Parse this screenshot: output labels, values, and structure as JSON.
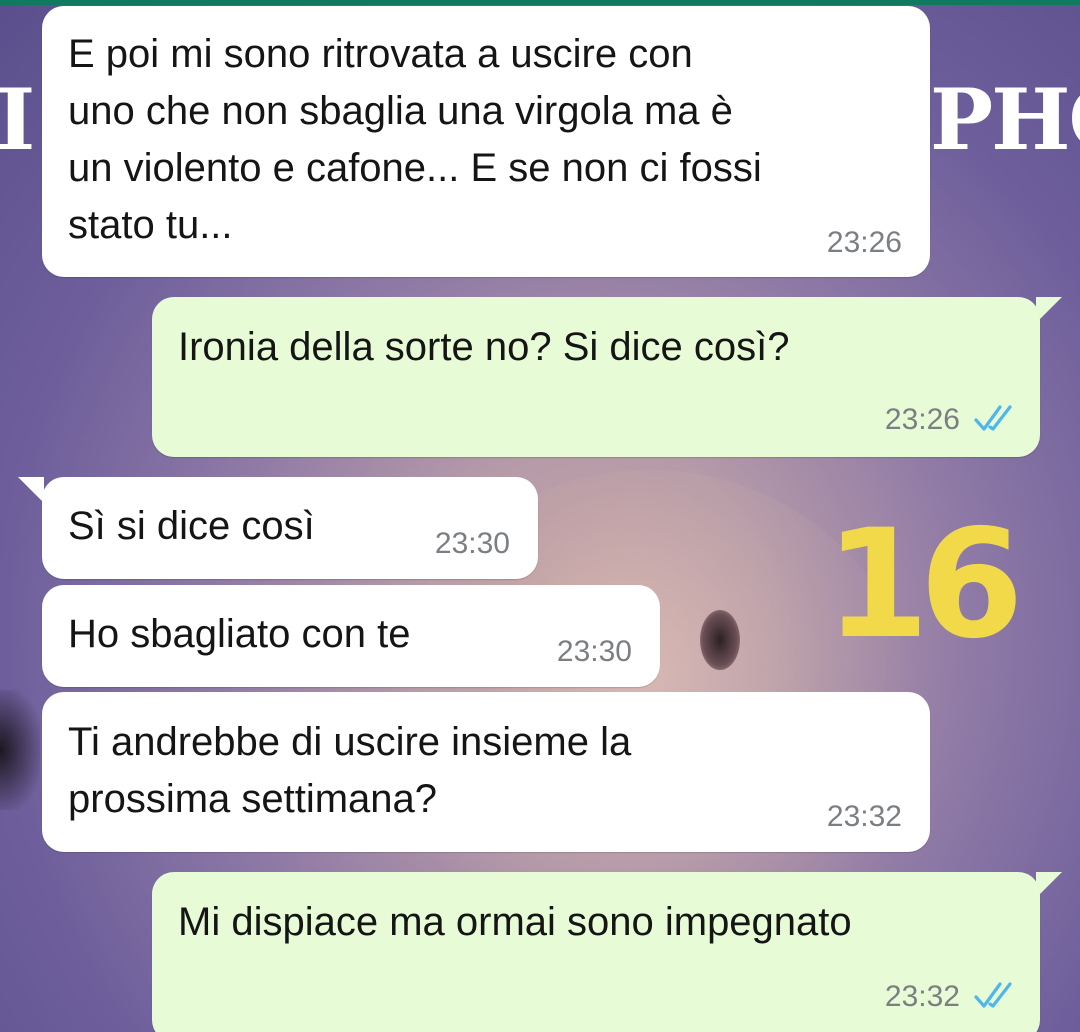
{
  "background": {
    "overlay_letters_left": "I",
    "overlay_letters_right": "PHC",
    "annotation": "16"
  },
  "colors": {
    "incoming_bubble": "#ffffff",
    "outgoing_bubble": "#e7fcd6",
    "read_ticks": "#4fb6ec",
    "time_text": "#7b7f83",
    "annotation": "#f2d94a"
  },
  "messages": [
    {
      "direction": "in",
      "text": "E poi mi sono ritrovata a uscire con\nuno che non sbaglia una virgola ma è\nun violento e cafone... E se non ci fossi\nstato tu...",
      "time": "23:26"
    },
    {
      "direction": "out",
      "text": "Ironia della sorte no? Si dice così?",
      "time": "23:26",
      "status_icon": "double-check-read-icon"
    },
    {
      "direction": "in",
      "text": "Sì si dice così",
      "time": "23:30"
    },
    {
      "direction": "in",
      "text": "Ho sbagliato con te",
      "time": "23:30"
    },
    {
      "direction": "in",
      "text": "Ti andrebbe di uscire insieme la\nprossima settimana?",
      "time": "23:32"
    },
    {
      "direction": "out",
      "text": "Mi dispiace ma ormai sono impegnato",
      "time": "23:32",
      "status_icon": "double-check-read-icon"
    }
  ]
}
